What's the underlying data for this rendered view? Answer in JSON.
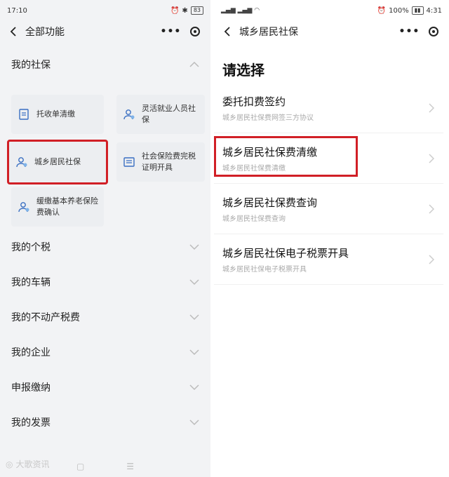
{
  "left": {
    "status_time": "17:10",
    "status_signal": "444 HD",
    "status_battery": "83",
    "nav_title": "全部功能",
    "section_title": "我的社保",
    "tiles": [
      {
        "label": "托收单清缴"
      },
      {
        "label": "灵活就业人员社保"
      },
      {
        "label": "城乡居民社保"
      },
      {
        "label": "社会保险费完税证明开具"
      },
      {
        "label": "缓缴基本养老保险费确认"
      }
    ],
    "rows": [
      "我的个税",
      "我的车辆",
      "我的不动产税费",
      "我的企业",
      "申报缴纳",
      "我的发票"
    ],
    "watermark": "大歌资讯"
  },
  "right": {
    "status_time": "4:31",
    "status_battery": "100%",
    "nav_title": "城乡居民社保",
    "heading": "请选择",
    "options": [
      {
        "title": "委托扣费签约",
        "subtitle": "城乡居民社保费网签三方协议"
      },
      {
        "title": "城乡居民社保费清缴",
        "subtitle": "城乡居民社保费清缴"
      },
      {
        "title": "城乡居民社保费查询",
        "subtitle": "城乡居民社保费查询"
      },
      {
        "title": "城乡居民社保电子税票开具",
        "subtitle": "城乡居民社保电子税票开具"
      }
    ]
  },
  "colors": {
    "highlight": "#d11f26",
    "tile_bg": "#eceef1",
    "panel_bg": "#f2f3f5"
  }
}
